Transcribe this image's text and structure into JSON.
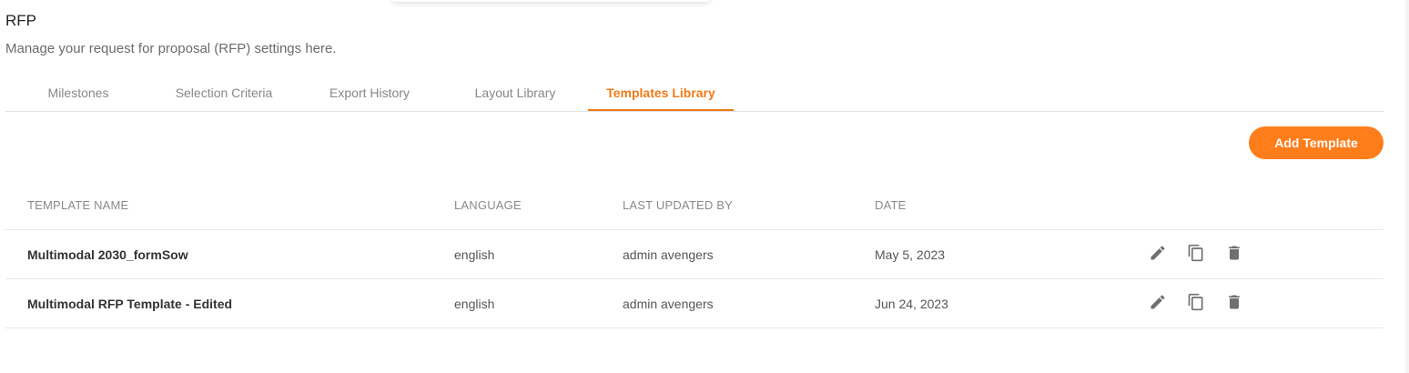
{
  "page": {
    "title": "RFP",
    "subtitle": "Manage your request for proposal (RFP) settings here."
  },
  "tabs": [
    {
      "label": "Milestones",
      "active": false
    },
    {
      "label": "Selection Criteria",
      "active": false
    },
    {
      "label": "Export History",
      "active": false
    },
    {
      "label": "Layout Library",
      "active": false
    },
    {
      "label": "Templates Library",
      "active": true
    }
  ],
  "toolbar": {
    "add_label": "Add Template"
  },
  "table": {
    "headers": {
      "name": "TEMPLATE NAME",
      "language": "LANGUAGE",
      "updated_by": "LAST UPDATED BY",
      "date": "DATE"
    },
    "rows": [
      {
        "name": "Multimodal 2030_formSow",
        "language": "english",
        "updated_by": "admin avengers",
        "date": "May 5, 2023"
      },
      {
        "name": "Multimodal RFP Template - Edited",
        "language": "english",
        "updated_by": "admin avengers",
        "date": "Jun 24, 2023"
      }
    ],
    "row_actions": [
      "pencil-icon",
      "copy-icon",
      "trash-icon"
    ]
  },
  "colors": {
    "accent": "#ff7d1a",
    "active_tab": "#f07a16"
  }
}
